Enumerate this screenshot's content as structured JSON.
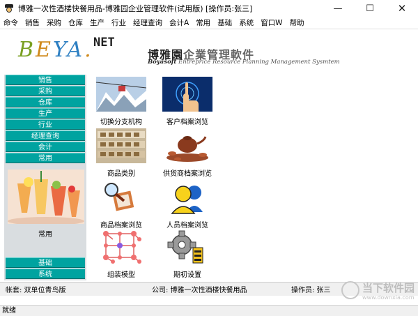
{
  "window": {
    "title": "博雅一次性酒楼快餐用品-博雅园企业管理软件(试用版) [操作员:张三]",
    "controls": {
      "minimize": "—",
      "maximize": "☐",
      "close": "✕"
    }
  },
  "menu": [
    "命令",
    "销售",
    "采购",
    "仓库",
    "生产",
    "行业",
    "经理查询",
    "会计A",
    "常用",
    "基础",
    "系统",
    "窗口W",
    "帮助"
  ],
  "banner": {
    "logo_b": "B",
    "logo_e": "E",
    "logo_ya": "YA",
    "logo_dot": ".",
    "logo_net": "NET",
    "brand_cn_a": "博雅園",
    "brand_cn_b": "企業管理軟件",
    "brand_en_a": "Boyasoft",
    "brand_en_b": "Entreprice Resource Planning Management Sysmtem"
  },
  "nav": {
    "items_top": [
      "销售",
      "采购",
      "仓库",
      "生产",
      "行业",
      "经理查询",
      "会计",
      "常用"
    ],
    "caption": "常用",
    "items_bottom": [
      "基础",
      "系统"
    ]
  },
  "tiles": [
    {
      "label": "切换分支机构",
      "icon": "cable-car-icon"
    },
    {
      "label": "客户档案浏览",
      "icon": "hand-touch-icon"
    },
    {
      "label": "商品类别",
      "icon": "warehouse-shelves-icon"
    },
    {
      "label": "供货商档案浏览",
      "icon": "teapot-icon"
    },
    {
      "label": "商品档案浏览",
      "icon": "magnifier-icon"
    },
    {
      "label": "人员档案浏览",
      "icon": "person-icon"
    },
    {
      "label": "组装模型",
      "icon": "molecule-icon"
    },
    {
      "label": "期初设置",
      "icon": "gear-icon"
    }
  ],
  "status": {
    "account": "帐套:   双单位青鸟版",
    "company": "公司:   博雅一次性酒楼快餐用品",
    "operator": "操作员:   张三",
    "ready": "就绪"
  },
  "watermark": {
    "text": "当下软件园",
    "url": "www.downxia.com"
  },
  "colors": {
    "nav_button": "#00a3a0",
    "nav_panel": "#d9dde0"
  }
}
